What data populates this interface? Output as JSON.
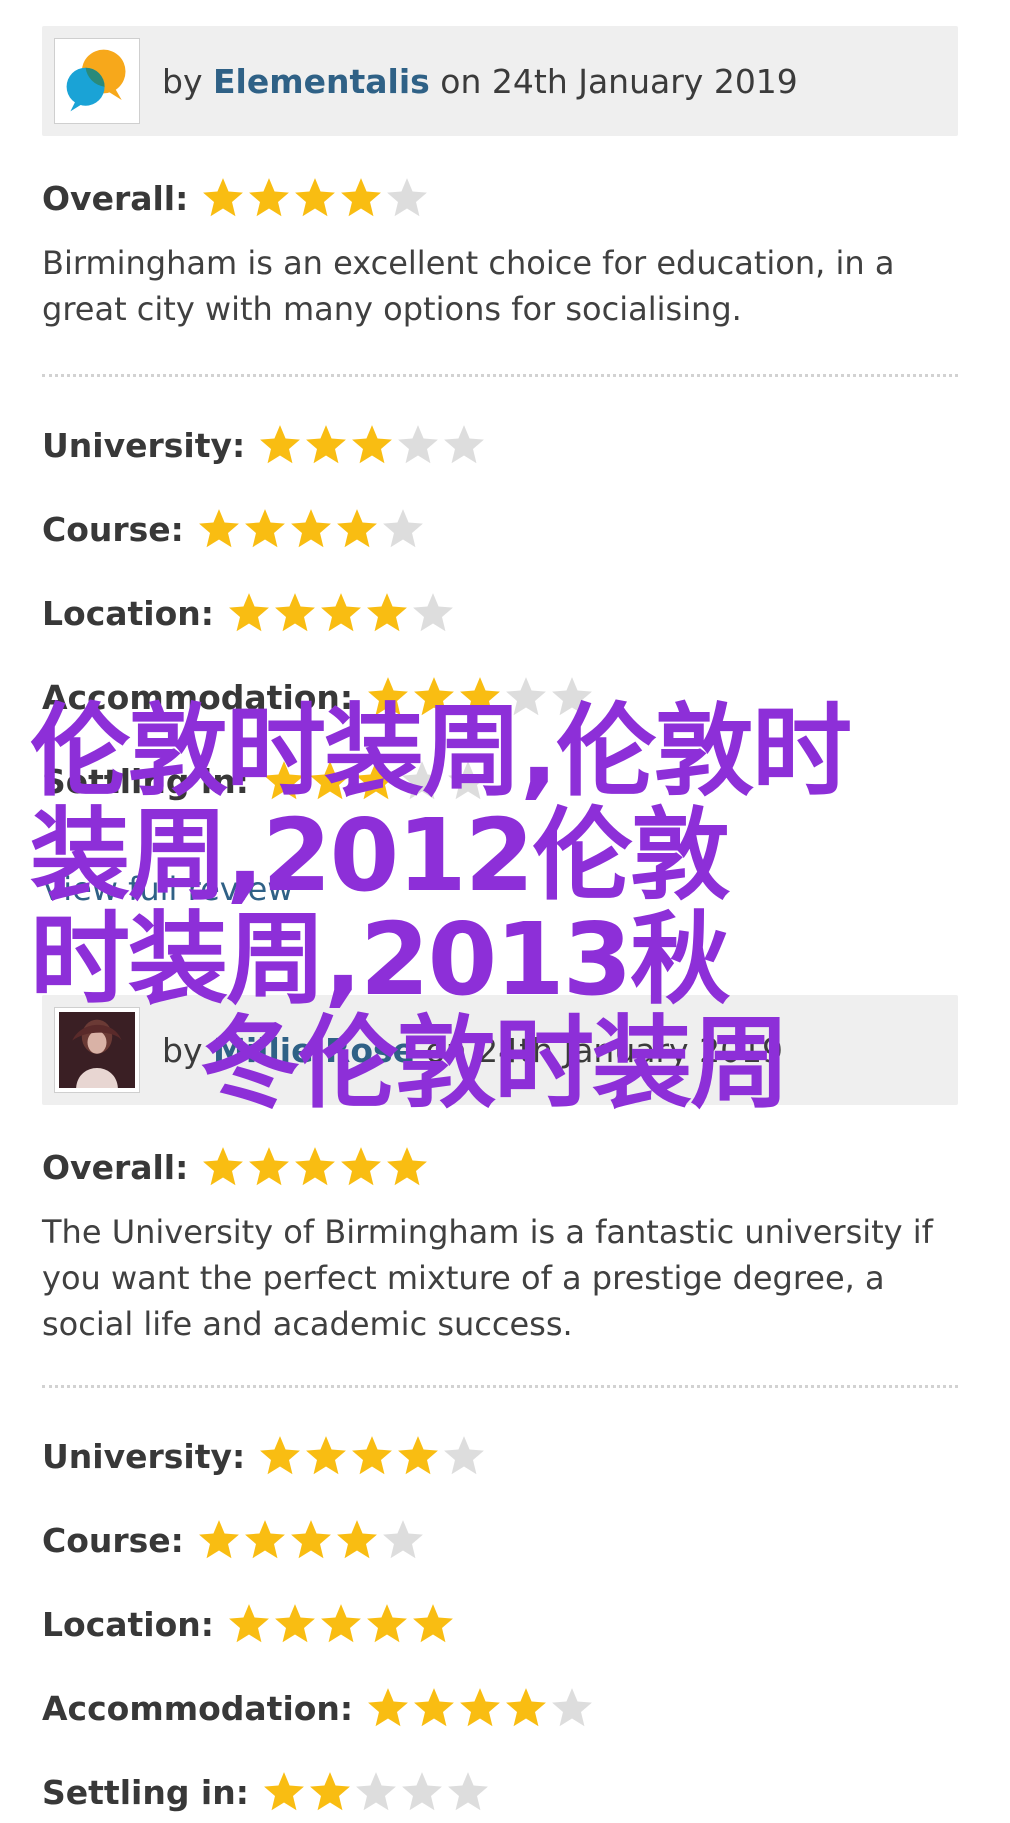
{
  "reviews": [
    {
      "by_prefix": "by",
      "author": "Elementalis",
      "on_text": "on 24th January 2019",
      "avatar_icon": "speech-bubbles-logo-icon",
      "overall": {
        "label": "Overall:",
        "stars": 4
      },
      "text": "Birmingham is an excellent choice for education, in a great city with many options for socialising.",
      "ratings": [
        {
          "label": "University:",
          "stars": 3
        },
        {
          "label": "Course:",
          "stars": 4
        },
        {
          "label": "Location:",
          "stars": 4
        },
        {
          "label": "Accommodation:",
          "stars": 3
        },
        {
          "label": "Settling in:",
          "stars": 3
        }
      ]
    },
    {
      "by_prefix": "by",
      "author": "Millie Rose",
      "on_text": "on 24th January 2019",
      "avatar_icon": "user-photo-avatar",
      "overall": {
        "label": "Overall:",
        "stars": 5
      },
      "text": "The University of Birmingham is a fantastic university if you want the perfect mixture of a prestige degree, a social life and academic success.",
      "ratings": [
        {
          "label": "University:",
          "stars": 4
        },
        {
          "label": "Course:",
          "stars": 4
        },
        {
          "label": "Location:",
          "stars": 5
        },
        {
          "label": "Accommodation:",
          "stars": 4
        },
        {
          "label": "Settling in:",
          "stars": 2
        }
      ]
    }
  ],
  "view_full_review": "View full review",
  "watermark": {
    "line1": "伦敦时装周,伦敦时",
    "line2": "装周,2012伦敦",
    "line3": "时装周,2013秋",
    "line4": "冬伦敦时装周"
  },
  "colors": {
    "star_filled": "#f9bd12",
    "star_empty": "#dddddd",
    "author_link": "#2f6186",
    "watermark": "#8d2fd8"
  }
}
